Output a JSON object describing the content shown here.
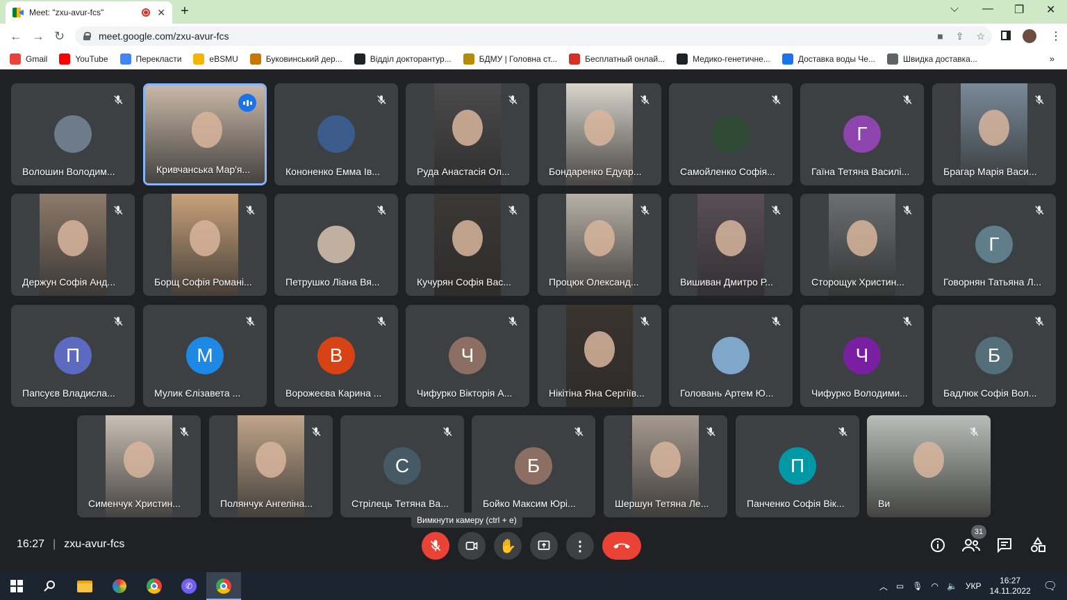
{
  "browser": {
    "tab_title": "Meet: \"zxu-avur-fcs\"",
    "url": "meet.google.com/zxu-avur-fcs",
    "bookmarks": [
      {
        "label": "Gmail",
        "icon": "gmail-icon",
        "color": "#ea4335"
      },
      {
        "label": "YouTube",
        "icon": "youtube-icon",
        "color": "#ff0000"
      },
      {
        "label": "Перекласти",
        "icon": "translate-icon",
        "color": "#4285f4"
      },
      {
        "label": "eBSMU",
        "icon": "ebsmu-icon",
        "color": "#f4b400"
      },
      {
        "label": "Буковинський дер...",
        "icon": "university-icon",
        "color": "#c77700"
      },
      {
        "label": "Відділ докторантур...",
        "icon": "globe-icon",
        "color": "#202124"
      },
      {
        "label": "БДМУ | Головна ст...",
        "icon": "emblem-icon",
        "color": "#b58b00"
      },
      {
        "label": "Бесплатный онлай...",
        "icon": "qr-icon",
        "color": "#d93025"
      },
      {
        "label": "Медико-генетичне...",
        "icon": "globe-icon",
        "color": "#202124"
      },
      {
        "label": "Доставка воды Че...",
        "icon": "water-drop-icon",
        "color": "#1a73e8"
      },
      {
        "label": "Швидка доставка...",
        "icon": "delivery-icon",
        "color": "#5f6368"
      }
    ],
    "more": "»"
  },
  "participants": [
    {
      "name": "Волошин Володим...",
      "type": "photo",
      "color": "#6d7b8a"
    },
    {
      "name": "Кривчанська Мар'я...",
      "type": "video",
      "color": "#c9b8a8",
      "speaking": true
    },
    {
      "name": "Кононенко Емма Ів...",
      "type": "photo",
      "color": "#3a5b8c"
    },
    {
      "name": "Руда Анастасія Ол...",
      "type": "video",
      "color": "#4a4a4a"
    },
    {
      "name": "Бондаренко Едуар...",
      "type": "video",
      "color": "#d9d4cc"
    },
    {
      "name": "Самойленко Софія...",
      "type": "photo",
      "color": "#2e4a35"
    },
    {
      "name": "Гаїна Тетяна Василі...",
      "type": "letter",
      "letter": "Г",
      "color": "#8e44ad"
    },
    {
      "name": "Брагар Марія Васи...",
      "type": "video",
      "color": "#7a8a99"
    },
    {
      "name": "Держун Софія Анд...",
      "type": "video",
      "color": "#8d7a6a"
    },
    {
      "name": "Борщ Софія Романі...",
      "type": "video",
      "color": "#c8a27a"
    },
    {
      "name": "Петрушко Ліана Вя...",
      "type": "photo",
      "color": "#c0b0a0"
    },
    {
      "name": "Кучурян Софія Вас...",
      "type": "video",
      "color": "#3b3835"
    },
    {
      "name": "Процюк Олександ...",
      "type": "video",
      "color": "#b8b0a6"
    },
    {
      "name": "Вишиван Дмитро Р...",
      "type": "video",
      "color": "#5a4e57"
    },
    {
      "name": "Сторощук Христин...",
      "type": "video",
      "color": "#6b6f70"
    },
    {
      "name": "Говорнян Татьяна Л...",
      "type": "letter",
      "letter": "Г",
      "color": "#607d8b"
    },
    {
      "name": "Папсуєв Владисла...",
      "type": "letter",
      "letter": "П",
      "color": "#5c6bc0"
    },
    {
      "name": "Мулик Єлізавета ...",
      "type": "letter",
      "letter": "М",
      "color": "#1e88e5"
    },
    {
      "name": "Ворожеєва Карина ...",
      "type": "letter",
      "letter": "В",
      "color": "#d84315"
    },
    {
      "name": "Чифурко Вікторія А...",
      "type": "letter",
      "letter": "Ч",
      "color": "#8d6e63"
    },
    {
      "name": "Нікітіна Яна Сергіїв...",
      "type": "video",
      "color": "#3a332e"
    },
    {
      "name": "Головань Артем Ю...",
      "type": "photo",
      "color": "#7fa7c9"
    },
    {
      "name": "Чифурко Володими...",
      "type": "letter",
      "letter": "Ч",
      "color": "#7b1fa2"
    },
    {
      "name": "Бадлюк Софія Вол...",
      "type": "letter",
      "letter": "Б",
      "color": "#546e7a"
    },
    {
      "name": "Сименчук Христин...",
      "type": "video",
      "color": "#c9bfb4"
    },
    {
      "name": "Полянчук Ангеліна...",
      "type": "video",
      "color": "#bfa58a"
    },
    {
      "name": "Стрілець Тетяна Ва...",
      "type": "letter",
      "letter": "С",
      "color": "#455a64"
    },
    {
      "name": "Бойко Максим Юрі...",
      "type": "letter",
      "letter": "Б",
      "color": "#8d6e63"
    },
    {
      "name": "Шершун Тетяна Ле...",
      "type": "video",
      "color": "#a59a8f"
    },
    {
      "name": "Панченко Софія Вік...",
      "type": "letter",
      "letter": "П",
      "color": "#0097a7"
    },
    {
      "name": "Ви",
      "type": "video",
      "color": "#b9bdb8"
    }
  ],
  "bottom": {
    "time": "16:27",
    "separator": "|",
    "meeting_code": "zxu-avur-fcs",
    "tooltip": "Вимкнути камеру (ctrl + e)",
    "participant_count": "31"
  },
  "taskbar": {
    "language": "УКР",
    "time": "16:27",
    "date": "14.11.2022"
  }
}
